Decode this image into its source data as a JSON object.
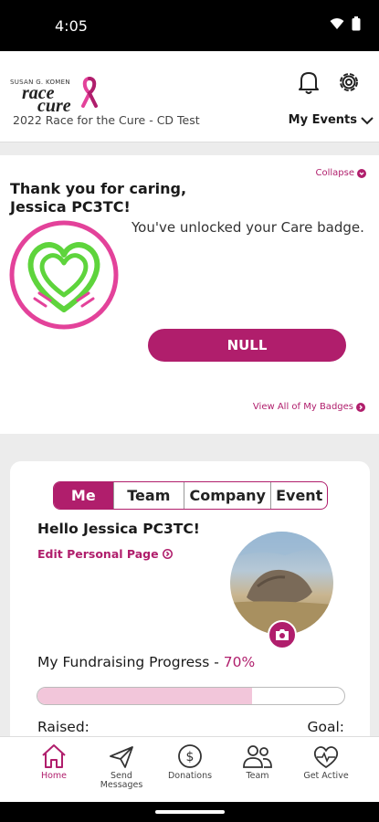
{
  "status_bar": {
    "time": "4:05"
  },
  "header": {
    "logo_small_text": "SUSAN G. KOMEN",
    "logo_word_1": "race",
    "logo_word_2": "cure",
    "event_name": "2022 Race for the Cure - CD Test",
    "my_events_label": "My Events"
  },
  "badge_card": {
    "collapse_label": "Collapse",
    "title": "Thank you for caring, Jessica PC3TC!",
    "unlock_message": "You've unlocked your Care badge.",
    "button_label": "NULL",
    "view_all_label": "View All of My Badges"
  },
  "progress_card": {
    "tabs": [
      {
        "label": "Me"
      },
      {
        "label": "Team"
      },
      {
        "label": "Company"
      },
      {
        "label": "Event"
      }
    ],
    "greeting": "Hello Jessica PC3TC!",
    "edit_label": "Edit Personal Page",
    "fundraising_label": "My Fundraising Progress - ",
    "fundraising_percent": "70%",
    "progress_value": 0.7,
    "raised_label": "Raised:",
    "goal_label": "Goal:"
  },
  "bottom_nav": [
    {
      "label": "Home",
      "icon": "home-icon"
    },
    {
      "label": "Send Messages",
      "icon": "paper-plane-icon"
    },
    {
      "label": "Donations",
      "icon": "dollar-coin-icon"
    },
    {
      "label": "Team",
      "icon": "team-icon"
    },
    {
      "label": "Get Active",
      "icon": "heart-pulse-icon"
    }
  ],
  "colors": {
    "accent": "#b01e6c",
    "badge_green": "#5ed43c",
    "badge_pink": "#e3429a",
    "progress_fill": "#f2c6da"
  }
}
